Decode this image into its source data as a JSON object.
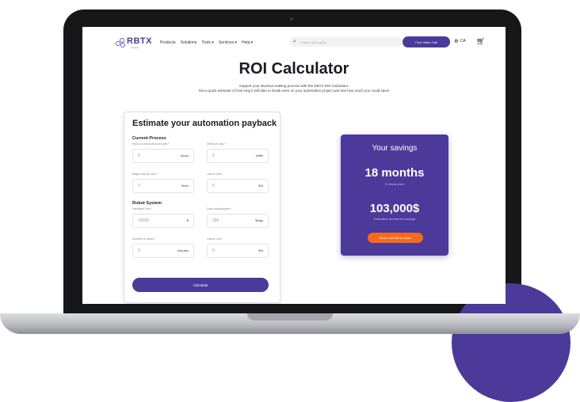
{
  "nav": {
    "logo": "RBTX",
    "logo_sub": "by igus",
    "items": [
      "Products",
      "Solutions",
      "Tools ▾",
      "Services ▾",
      "Help ▾"
    ],
    "search_placeholder": "Search robot parts",
    "cta": "Free Video Call",
    "lang": "CA"
  },
  "hero": {
    "title": "ROI Calculator",
    "intro_1": "Support your decision-making process with the RBTX ROI Calculator.",
    "intro_2": "Get a quick estimate of how long it will take to break even on your automation project and see how much you could save!"
  },
  "form": {
    "title": "Estimate your automation payback",
    "current_process": "Current Process",
    "robot_system": "Robot System",
    "fields": {
      "hours": {
        "label": "Hours of production per shift *",
        "value": "0",
        "unit": "hours"
      },
      "shifts": {
        "label": "Shifts per day *",
        "value": "0",
        "unit": "shifts"
      },
      "wage": {
        "label": "Wage cost per hour *",
        "value": "0",
        "unit": "/hour"
      },
      "labour": {
        "label": "Labour cost *",
        "value": "0",
        "unit": "$/h"
      },
      "hardware": {
        "label": "Hardware cost *",
        "value": "15000",
        "unit": "$"
      },
      "days": {
        "label": "Days working/year *",
        "value": "250",
        "unit": "$/day"
      },
      "minutes": {
        "label": "Number of robots *",
        "value": "0",
        "unit": "minutes"
      },
      "labour2": {
        "label": "Labour cost *",
        "value": "0",
        "unit": "$/h"
      }
    },
    "button": "Calculate"
  },
  "savings": {
    "title": "Your savings",
    "months": "18 months",
    "break_even": "To break even",
    "amount": "103,000$",
    "estimated": "Estimated annual net savings",
    "button": "Book a call with an expert"
  },
  "colors": {
    "brand": "#4b3a99",
    "accent": "#f46a1f"
  }
}
